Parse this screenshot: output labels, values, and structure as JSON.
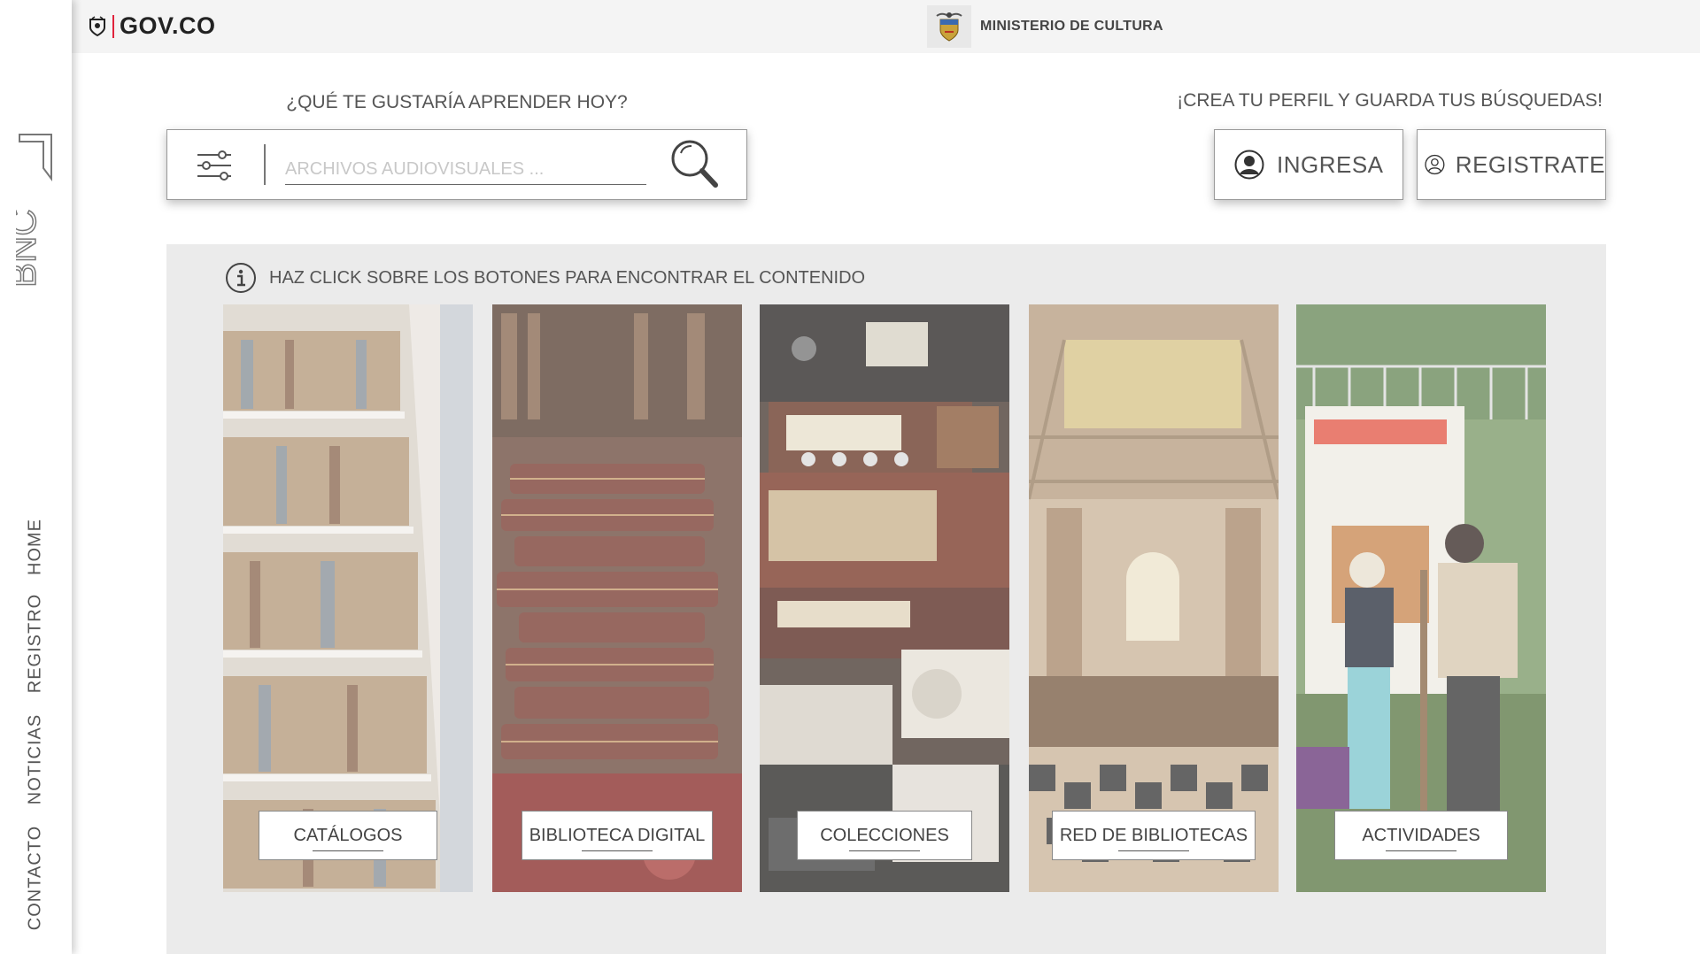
{
  "gov_bar": {
    "logo_text": "GOV.CO",
    "ministry": "MINISTERIO DE CULTURA"
  },
  "sidebar": {
    "logo_text": "BNC",
    "nav": [
      {
        "label": "HOME"
      },
      {
        "label": "REGISTRO"
      },
      {
        "label": "NOTICIAS"
      },
      {
        "label": "CONTACTO"
      }
    ]
  },
  "search": {
    "title": "¿QUÉ TE GUSTARÍA APRENDER HOY?",
    "placeholder": "ARCHIVOS AUDIOVISUALES ...",
    "value": ""
  },
  "profile": {
    "title": "¡CREA TU PERFIL Y GUARDA TUS BÚSQUEDAS!",
    "login_label": "INGRESA",
    "register_label": "REGISTRATE"
  },
  "panel": {
    "info_text": "HAZ CLICK SOBRE LOS BOTONES PARA ENCONTRAR EL CONTENIDO",
    "cards": [
      {
        "label": "CATÁLOGOS"
      },
      {
        "label": "BIBLIOTECA DIGITAL"
      },
      {
        "label": "COLECCIONES"
      },
      {
        "label": "RED DE BIBLIOTECAS"
      },
      {
        "label": "ACTIVIDADES"
      }
    ]
  },
  "colors": {
    "panel_bg": "#ebebeb",
    "gov_bar_bg": "#f4f4f4",
    "gov_accent": "#e0233c"
  }
}
